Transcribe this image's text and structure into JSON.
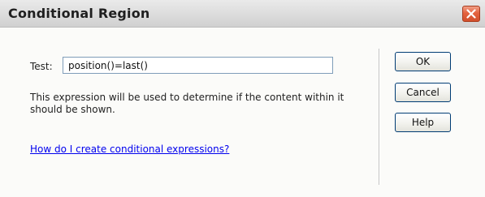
{
  "dialog": {
    "title": "Conditional Region",
    "close_icon": "close-icon"
  },
  "form": {
    "test_label": "Test:",
    "test_value": "position()=last()",
    "description": "This expression will be used to determine if the content within it should be shown.",
    "help_link": "How do I create conditional expressions?"
  },
  "buttons": {
    "ok": "OK",
    "cancel": "Cancel",
    "help": "Help"
  },
  "colors": {
    "close_button": "#e4623f",
    "link": "#0000ee"
  }
}
